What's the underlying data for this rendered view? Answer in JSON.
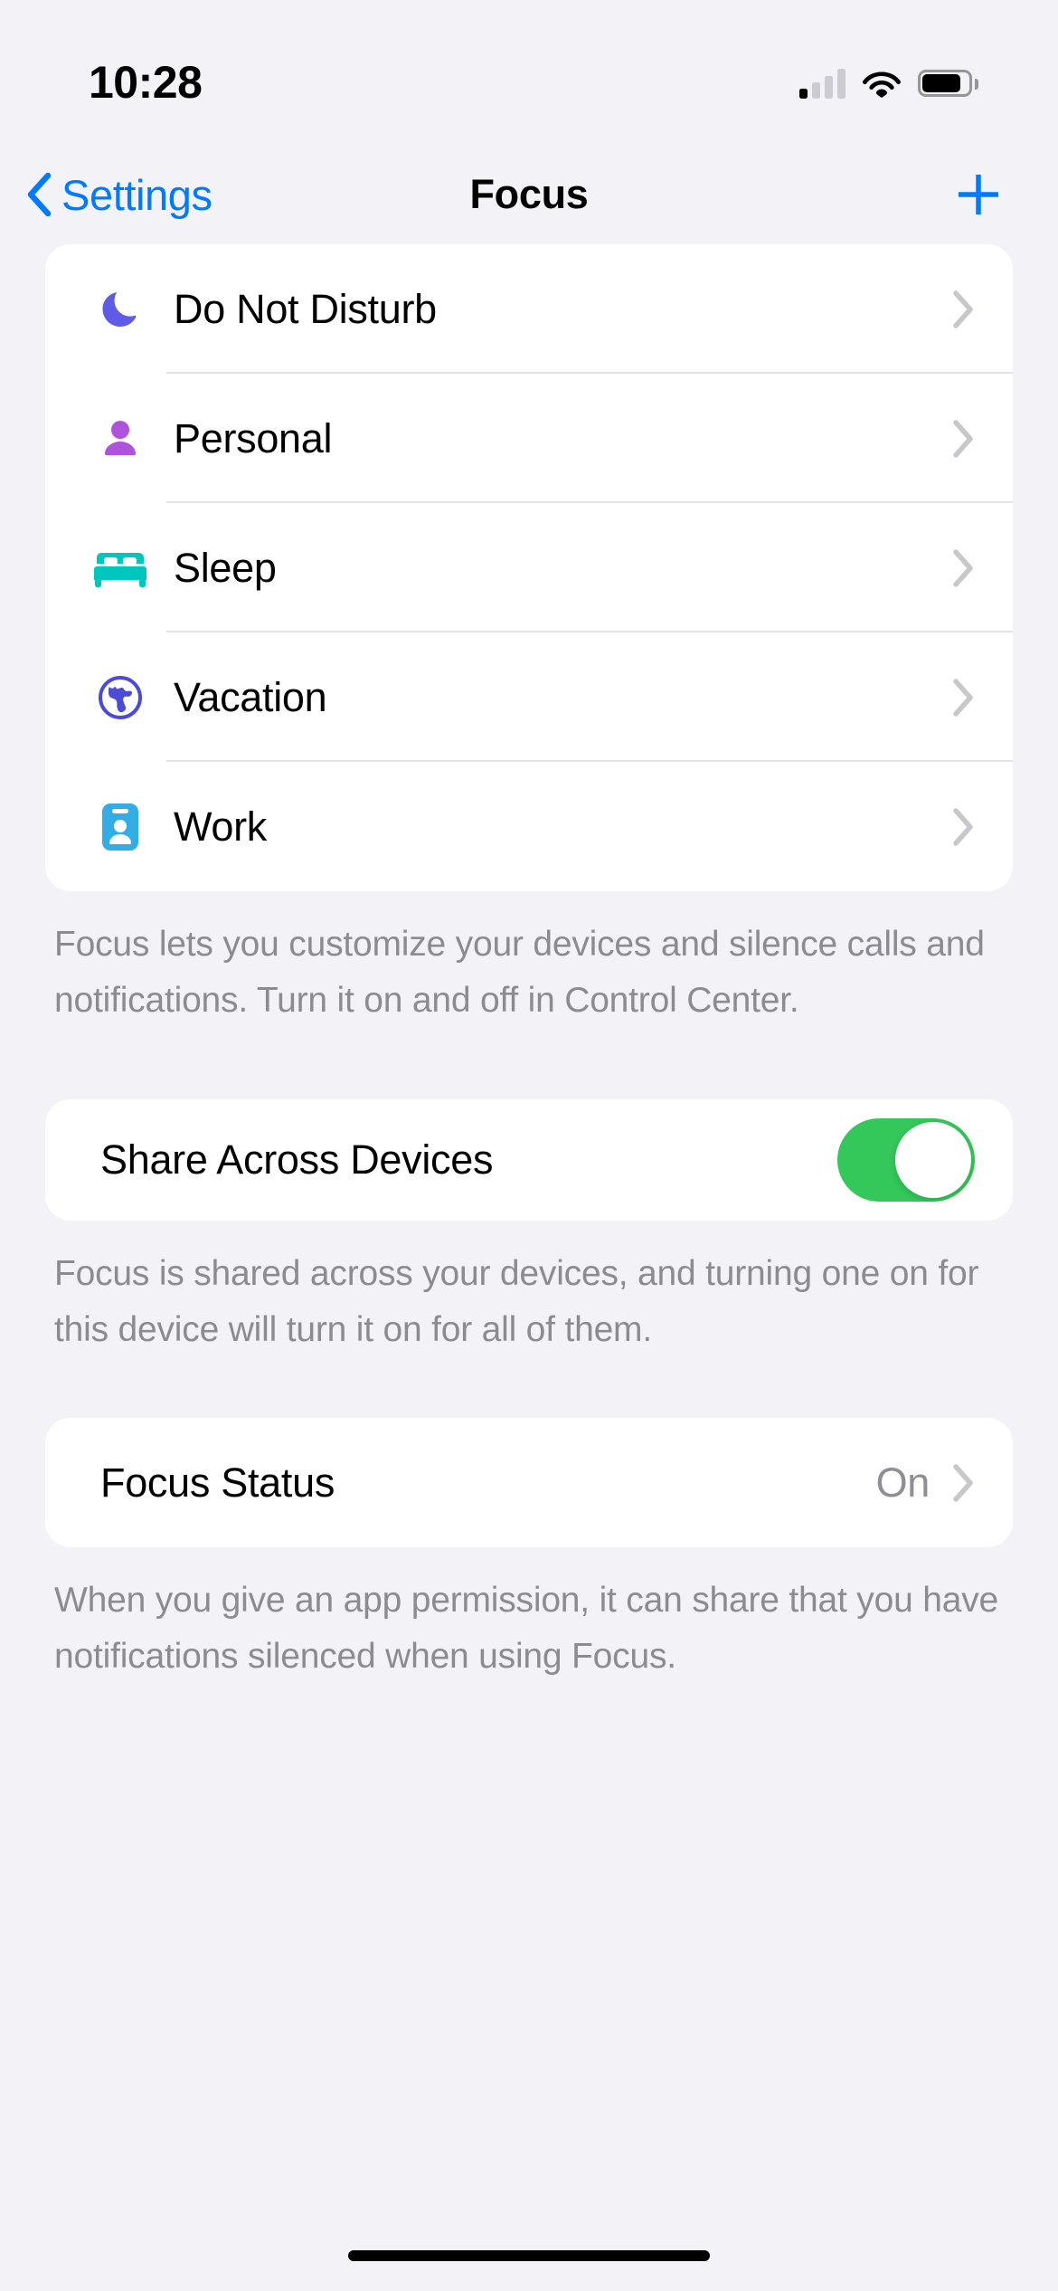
{
  "status_bar": {
    "time": "10:28",
    "signal_icon": "cellular-signal-icon",
    "signal_bars_filled": 1,
    "signal_bars_total": 4,
    "wifi_icon": "wifi-icon",
    "battery_icon": "battery-icon"
  },
  "nav": {
    "back_label": "Settings",
    "back_icon": "chevron-left-icon",
    "title": "Focus",
    "add_icon": "plus-icon"
  },
  "focus_list": {
    "items": [
      {
        "label": "Do Not Disturb",
        "icon": "moon-icon",
        "color": "#5E5CE6"
      },
      {
        "label": "Personal",
        "icon": "person-icon",
        "color": "#AF52DE"
      },
      {
        "label": "Sleep",
        "icon": "bed-icon",
        "color": "#00C7BE"
      },
      {
        "label": "Vacation",
        "icon": "globe-icon",
        "color": "#4B4BD8"
      },
      {
        "label": "Work",
        "icon": "badge-icon",
        "color": "#32ADE6"
      }
    ],
    "footer": "Focus lets you customize your devices and silence calls and notifications. Turn it on and off in Control Center."
  },
  "share_across_devices": {
    "label": "Share Across Devices",
    "toggle_state": "on",
    "toggle_color": "#34C759",
    "footer": "Focus is shared across your devices, and turning one on for this device will turn it on for all of them."
  },
  "focus_status": {
    "label": "Focus Status",
    "value": "On",
    "chevron_icon": "chevron-right-icon",
    "footer": "When you give an app permission, it can share that you have notifications silenced when using Focus."
  },
  "colors": {
    "accent": "#007AFF",
    "background": "#F2F2F7",
    "card": "#FFFFFF",
    "secondary_text": "#8E8E93",
    "chevron": "#C7C7CC"
  }
}
